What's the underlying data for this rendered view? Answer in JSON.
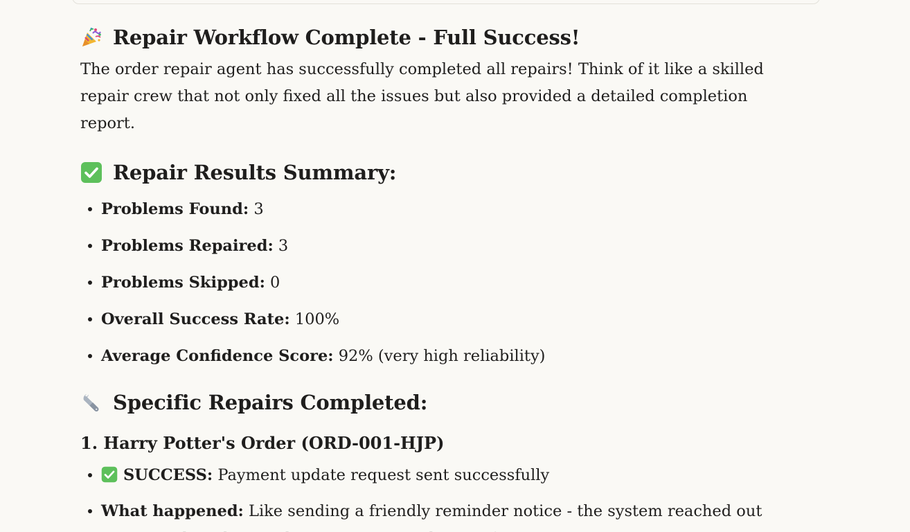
{
  "heading_complete": {
    "icon": "party-popper-icon",
    "text": "Repair Workflow Complete - Full Success!"
  },
  "intro": "The order repair agent has successfully completed all repairs! Think of it like a skilled repair crew that not only fixed all the issues but also provided a detailed completion report.",
  "summary": {
    "icon": "check-mark-icon",
    "heading": "Repair Results Summary:",
    "items": [
      {
        "label": "Problems Found:",
        "value": "3"
      },
      {
        "label": "Problems Repaired:",
        "value": "3"
      },
      {
        "label": "Problems Skipped:",
        "value": "0"
      },
      {
        "label": "Overall Success Rate:",
        "value": "100%"
      },
      {
        "label": "Average Confidence Score:",
        "value": "92% (very high reliability)"
      }
    ]
  },
  "repairs": {
    "icon": "wrench-icon",
    "heading": "Specific Repairs Completed:",
    "order_1": {
      "heading": "1. Harry Potter's Order (ORD-001-HJP)",
      "items": [
        {
          "icon": "check-mark-icon",
          "label": "SUCCESS:",
          "value": "Payment update request sent successfully"
        },
        {
          "label": "What happened:",
          "value": "Like sending a friendly reminder notice - the system reached out to Harry about his pending Gringotts Vault Transfer"
        }
      ]
    }
  },
  "colors": {
    "background": "#faf9f5",
    "text": "#1f1e1d",
    "check_green": "#5dc05b"
  }
}
